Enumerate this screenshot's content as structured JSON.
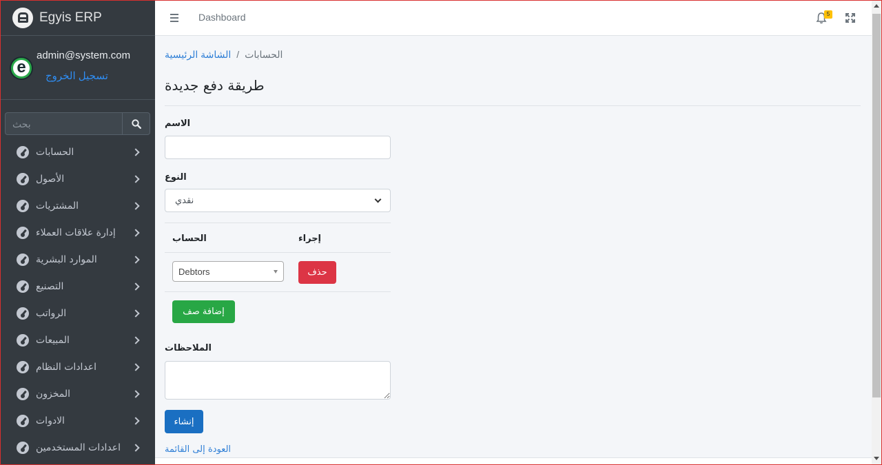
{
  "app": {
    "brand": "Egyis ERP"
  },
  "user": {
    "email": "admin@system.com",
    "logout_label": "تسجيل الخروج"
  },
  "sidebar": {
    "search_placeholder": "بحث",
    "items": [
      {
        "label": "الحسابات"
      },
      {
        "label": "الأصول"
      },
      {
        "label": "المشتريات"
      },
      {
        "label": "إدارة علاقات العملاء"
      },
      {
        "label": "الموارد البشرية"
      },
      {
        "label": "التصنيع"
      },
      {
        "label": "الرواتب"
      },
      {
        "label": "المبيعات"
      },
      {
        "label": "اعدادات النظام"
      },
      {
        "label": "المخزون"
      },
      {
        "label": "الادوات"
      },
      {
        "label": "اعدادات المستخدمين"
      }
    ]
  },
  "topbar": {
    "link": "Dashboard",
    "notifications_count": "5"
  },
  "breadcrumb": {
    "home": "الشاشة الرئيسية",
    "separator": "/",
    "current": "الحسابات"
  },
  "page": {
    "title": "طريقة دفع جديدة"
  },
  "form": {
    "name_label": "الاسم",
    "name_value": "",
    "type_label": "النوع",
    "type_value": "نقدي",
    "table": {
      "col_account": "الحساب",
      "col_action": "إجراء",
      "rows": [
        {
          "account": "Debtors",
          "delete_label": "حذف"
        }
      ]
    },
    "add_row_label": "إضافة صف",
    "notes_label": "الملاحظات",
    "notes_value": "",
    "create_label": "إنشاء",
    "back_label": "العودة إلى القائمة"
  },
  "colors": {
    "sidebar_bg": "#343a40",
    "primary": "#1a6fc2",
    "danger": "#dc3545",
    "success": "#28a745",
    "badge": "#ffc107"
  }
}
